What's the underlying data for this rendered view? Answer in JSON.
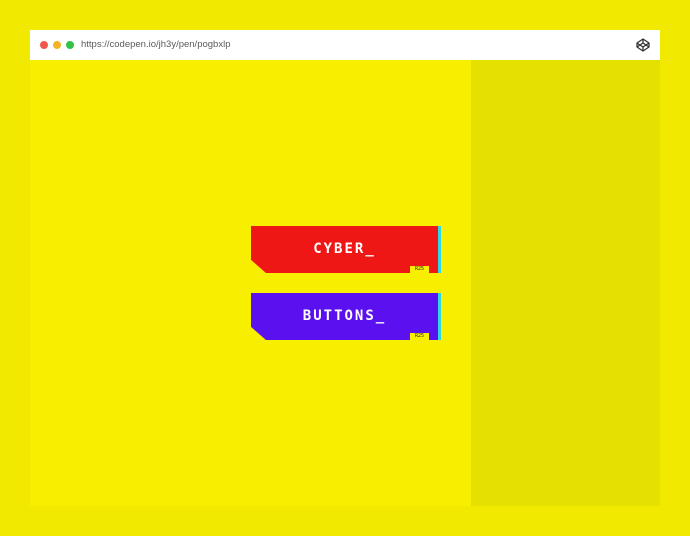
{
  "browser": {
    "url": "https://codepen.io/jh3y/pen/pogbxlp",
    "icon": "codepen-icon"
  },
  "buttons": [
    {
      "label": "CYBER_",
      "tag": "R25",
      "color": "#ef1616"
    },
    {
      "label": "BUTTONS_",
      "tag": "R25",
      "color": "#5b10ef"
    }
  ],
  "colors": {
    "background": "#f8ee00",
    "accent_cyan": "#2fd6e8"
  }
}
